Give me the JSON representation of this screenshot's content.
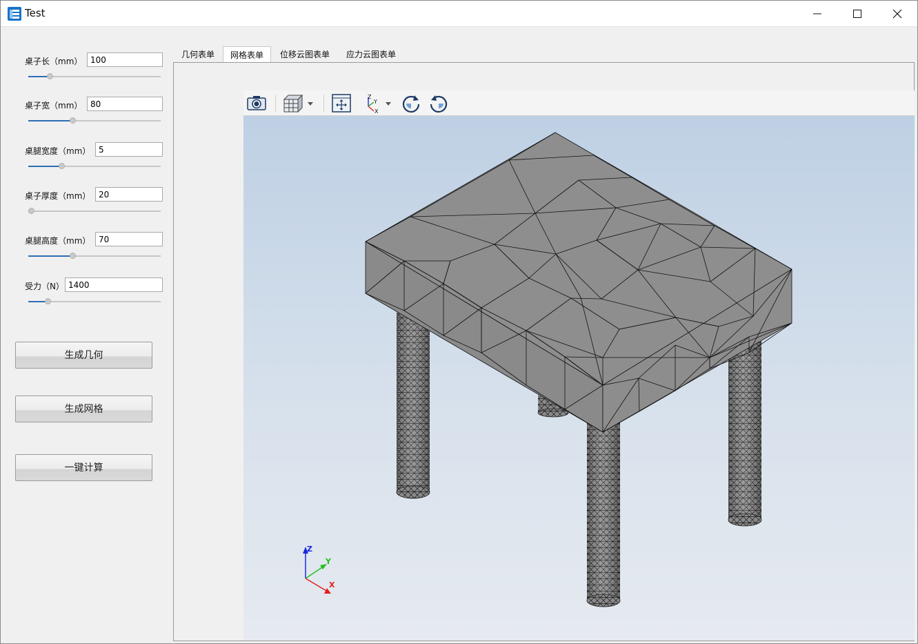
{
  "window": {
    "title": "Test"
  },
  "params": [
    {
      "label": "桌子长（mm）",
      "value": "100"
    },
    {
      "label": "桌子宽（mm）",
      "value": "80"
    },
    {
      "label": "桌腿宽度（mm）",
      "value": "5"
    },
    {
      "label": "桌子厚度（mm）",
      "value": "20"
    },
    {
      "label": "桌腿高度（mm）",
      "value": "70"
    },
    {
      "label": "受力（N）",
      "value": "1400"
    }
  ],
  "sliders": [
    0.15,
    0.33,
    0.24,
    0.0,
    0.33,
    0.13
  ],
  "buttons": {
    "generate_geometry": "生成几何",
    "generate_mesh": "生成网格",
    "one_click_compute": "一键计算"
  },
  "tabs": [
    {
      "label": "几何表单",
      "active": false
    },
    {
      "label": "网格表单",
      "active": true
    },
    {
      "label": "位移云图表单",
      "active": false
    },
    {
      "label": "应力云图表单",
      "active": false
    }
  ],
  "toolbar": {
    "icons": [
      "camera-icon",
      "view-cube-icon",
      "fit-all-icon",
      "axis-views-icon",
      "rotate-cw-icon",
      "rotate-ccw-icon"
    ]
  },
  "axes": {
    "x": "X",
    "y": "Y",
    "z": "Z"
  },
  "colors": {
    "mesh_face": "#8c8c8c",
    "accent": "#2d6db5",
    "axis_x": "#e02020",
    "axis_y": "#20c020",
    "axis_z": "#1a2adf"
  }
}
